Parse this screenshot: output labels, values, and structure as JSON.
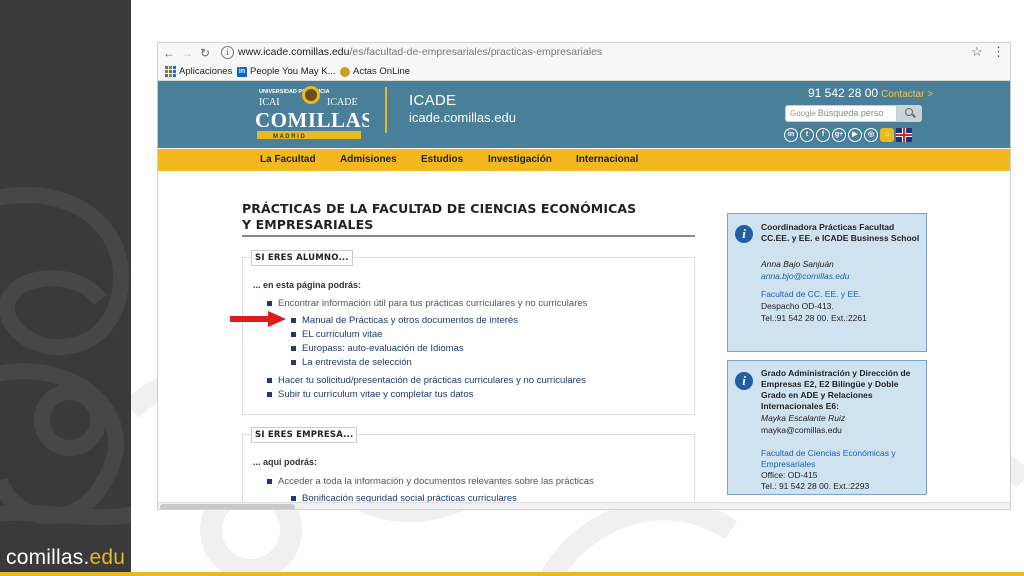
{
  "slide": {
    "brand_main": "comi",
    "brand_i": "l",
    "brand_rest": "las.",
    "brand_accent": "edu",
    "accent_color": "#e8b923",
    "dark_bar_color": "#3a3a3a"
  },
  "browser": {
    "url_domain": "www.icade.comillas.edu",
    "url_path": "/es/facultad-de-empresariales/practicas-empresariales",
    "bookmarks": [
      {
        "label": "Aplicaciones",
        "icon": "apps-grid-icon"
      },
      {
        "label": "People You May K...",
        "icon": "linkedin-icon"
      },
      {
        "label": "Actas OnLine",
        "icon": "actas-icon"
      }
    ]
  },
  "site": {
    "header_color": "#4a7f9a",
    "logo_top": "UNIVERSIDAD PONTIFICIA",
    "logo_icai": "ICAI",
    "logo_icade": "ICADE",
    "logo_name": "COMILLAS",
    "logo_city": "M A D R I D",
    "title": "ICADE",
    "subtitle": "icade.comillas.edu",
    "phone": "91 542 28 00",
    "contact": "Contactar >",
    "search_brand": "Google",
    "search_placeholder": "Búsqueda perso",
    "social": [
      "in",
      "t",
      "f",
      "g+",
      "▶",
      "◎",
      "⌂"
    ],
    "nav": [
      "La Facultad",
      "Admisiones",
      "Estudios",
      "Investigación",
      "Internacional"
    ],
    "nav_color": "#f2b81e"
  },
  "content": {
    "title": "PRÁCTICAS DE LA FACULTAD DE CIENCIAS ECONÓMICAS Y EMPRESARIALES",
    "alumno": {
      "tag": "SI ERES ALUMNO...",
      "intro": "... en esta página podrás:",
      "items": [
        "Encontrar información útil para tus prácticas curriculares y no curriculares",
        "Manual de Prácticas y otros documentos de interés",
        "EL curriculum vitae",
        "Europass: auto-evaluación de Idiomas",
        "La entrevista de selección",
        "Hacer tu solicitud/presentación de prácticas curriculares y no curriculares",
        "Subir tu currículum vitae y completar tus datos"
      ]
    },
    "empresa": {
      "tag": "SI ERES EMPRESA...",
      "intro": "... aquí podrás:",
      "items": [
        "Acceder a toda la información y documentos relevantes sobre las prácticas",
        "Bonificación seguridad social prácticas curriculares"
      ]
    }
  },
  "info1": {
    "heading": "Coordinadora Prácticas Facultad CC.EE. y EE. e ICADE Business School",
    "name": "Anna Bajo Sanjuán",
    "email": "anna.bjo@comillas.edu",
    "faculty": "Facultad de CC. EE. y EE.",
    "office": "Despacho OD-413.",
    "phone": "Tel.:91 542 28 00. Ext.:2261"
  },
  "info2": {
    "heading": "Grado Administración y Dirección de Empresas E2, E2 Bilingüe y Doble Grado en ADE y Relaciones Internacionales E6:",
    "name": "Mayka Escalante Ruiz",
    "email": "mayka@comillas.edu",
    "faculty": "Facultad de Ciencias Económicas y Empresariales",
    "office": "Office: OD-415",
    "phone": "Tel.: 91 542 28 00. Ext.:2293"
  }
}
